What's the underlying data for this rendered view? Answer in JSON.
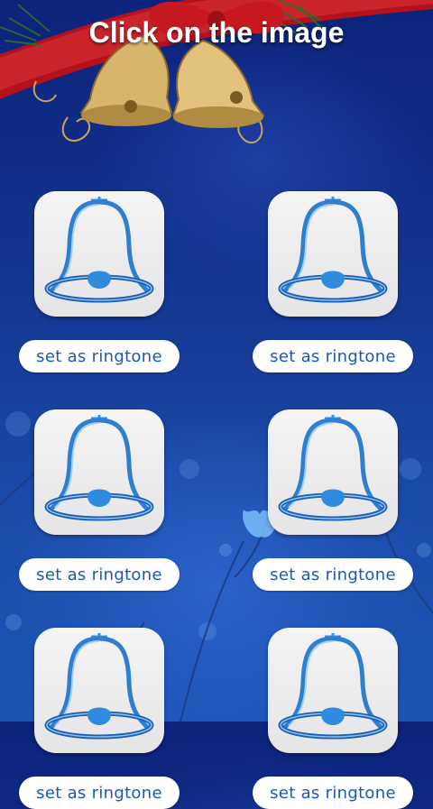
{
  "header": {
    "title": "Click on the image"
  },
  "items": [
    {
      "icon": "bell-icon",
      "button_label": "set as ringtone"
    },
    {
      "icon": "bell-icon",
      "button_label": "set as ringtone"
    },
    {
      "icon": "bell-icon",
      "button_label": "set as ringtone"
    },
    {
      "icon": "bell-icon",
      "button_label": "set as ringtone"
    },
    {
      "icon": "bell-icon",
      "button_label": "set as ringtone"
    },
    {
      "icon": "bell-icon",
      "button_label": "set as ringtone"
    }
  ],
  "colors": {
    "background": "#12348e",
    "button_text": "#1858b7",
    "tile": "#eeeeef",
    "bell_outline": "#2a86d6"
  }
}
